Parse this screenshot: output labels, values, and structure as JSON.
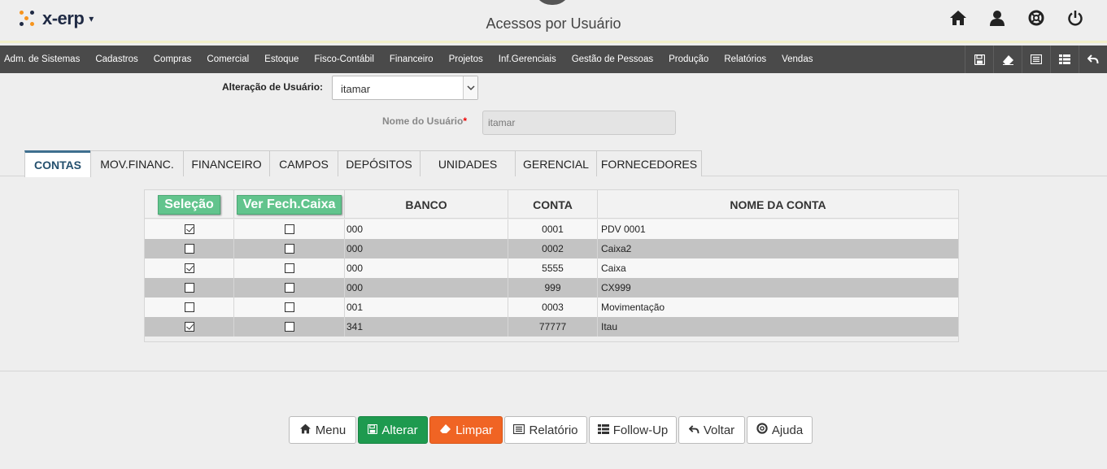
{
  "app": {
    "logo_text": "x-erp",
    "page_title": "Acessos por Usuário"
  },
  "header_icons": [
    "home-icon",
    "user-icon",
    "lifebuoy-icon",
    "power-icon"
  ],
  "menu": [
    "Adm. de Sistemas",
    "Cadastros",
    "Compras",
    "Comercial",
    "Estoque",
    "Fisco-Contábil",
    "Financeiro",
    "Projetos",
    "Inf.Gerenciais",
    "Gestão de Pessoas",
    "Produção",
    "Relatórios",
    "Vendas"
  ],
  "menu_actions": [
    "save-icon",
    "eraser-icon",
    "report-icon",
    "table-icon",
    "undo-icon"
  ],
  "form": {
    "user_label": "Alteração de Usuário:",
    "user_value": "itamar",
    "name_label": "Nome do Usuário",
    "name_required": "*",
    "name_value": "itamar"
  },
  "tabs": [
    {
      "label": "CONTAS",
      "active": true
    },
    {
      "label": "MOV.FINANC.",
      "active": false
    },
    {
      "label": "FINANCEIRO",
      "active": false
    },
    {
      "label": "CAMPOS",
      "active": false
    },
    {
      "label": "DEPÓSITOS",
      "active": false
    },
    {
      "label": "UNIDADES",
      "active": false
    },
    {
      "label": "GERENCIAL",
      "active": false
    },
    {
      "label": "FORNECEDORES",
      "active": false
    }
  ],
  "table": {
    "selection_button": "Seleção",
    "fech_button": "Ver Fech.Caixa",
    "col_banco": "BANCO",
    "col_conta": "CONTA",
    "col_nome": "NOME DA CONTA",
    "rows": [
      {
        "sel": true,
        "fech": false,
        "banco": "000",
        "conta": "0001",
        "nome": "PDV 0001"
      },
      {
        "sel": false,
        "fech": false,
        "banco": "000",
        "conta": "0002",
        "nome": "Caixa2"
      },
      {
        "sel": true,
        "fech": false,
        "banco": "000",
        "conta": "5555",
        "nome": "Caixa"
      },
      {
        "sel": false,
        "fech": false,
        "banco": "000",
        "conta": "999",
        "nome": "CX999"
      },
      {
        "sel": false,
        "fech": false,
        "banco": "001",
        "conta": "0003",
        "nome": "Movimentação"
      },
      {
        "sel": true,
        "fech": false,
        "banco": "341",
        "conta": "77777",
        "nome": "Itau"
      }
    ]
  },
  "footer": {
    "menu": "Menu",
    "alterar": "Alterar",
    "limpar": "Limpar",
    "relatorio": "Relatório",
    "followup": "Follow-Up",
    "voltar": "Voltar",
    "ajuda": "Ajuda"
  },
  "colors": {
    "accent_green": "#1e9a4f",
    "accent_orange": "#f06424",
    "select_button": "#62c48d",
    "menubar": "#4a4a4a",
    "tab_active": "#3f6f8f"
  }
}
